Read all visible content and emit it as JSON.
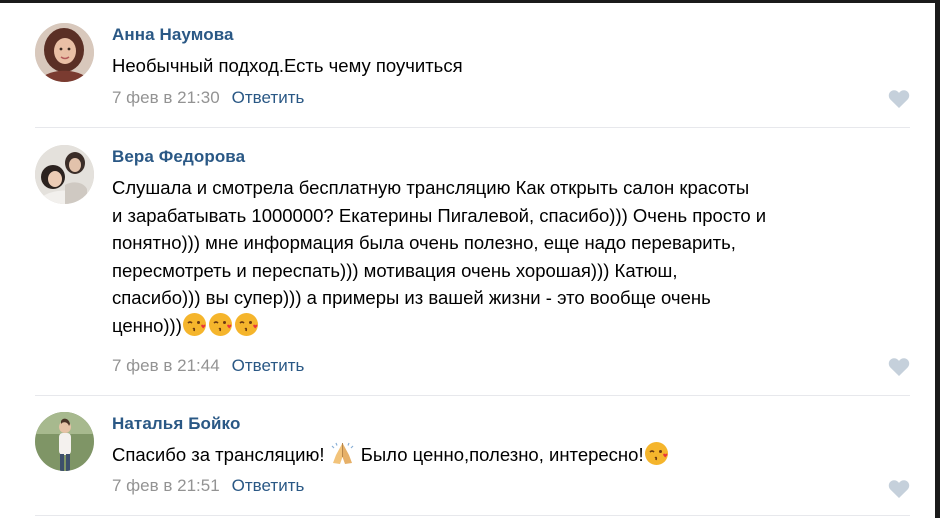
{
  "comments": [
    {
      "author": "Анна Наумова",
      "text": "Необычный подход.Есть чему поучиться",
      "date": "7 фев в 21:30",
      "reply_label": "Ответить",
      "avatar": "woman-portrait-icon",
      "like_icon": "heart-icon"
    },
    {
      "author": "Вера Федорова",
      "text_lines": [
        "Слушала и смотрела бесплатную трансляцию Как открыть салон красоты",
        "и зарабатывать 1000000? Екатерины Пигалевой, спасибо))) Очень просто и",
        "понятно))) мне информация была очень полезно, еще надо переварить,",
        "пересмотреть и переспать))) мотивация очень хорошая))) Катюш,",
        "спасибо))) вы супер))) а примеры из вашей жизни - это вообще очень",
        "ценно)))"
      ],
      "emojis": [
        "kissing-heart-emoji",
        "kissing-heart-emoji",
        "kissing-heart-emoji"
      ],
      "date": "7 фев в 21:44",
      "reply_label": "Ответить",
      "avatar": "woman-with-child-icon",
      "like_icon": "heart-icon"
    },
    {
      "author": "Наталья Бойко",
      "text_parts": [
        "Спасибо за трансляцию! ",
        " Было ценно,полезно, интересно!"
      ],
      "emojis": [
        "folded-hands-emoji",
        "kissing-heart-emoji"
      ],
      "date": "7 фев в 21:51",
      "reply_label": "Ответить",
      "avatar": "woman-standing-icon",
      "like_icon": "heart-icon"
    }
  ],
  "colors": {
    "author": "#2a5885",
    "reply": "#2a5885",
    "date": "#939393",
    "divider": "#e7e8ec",
    "like": "#c5d0db"
  }
}
